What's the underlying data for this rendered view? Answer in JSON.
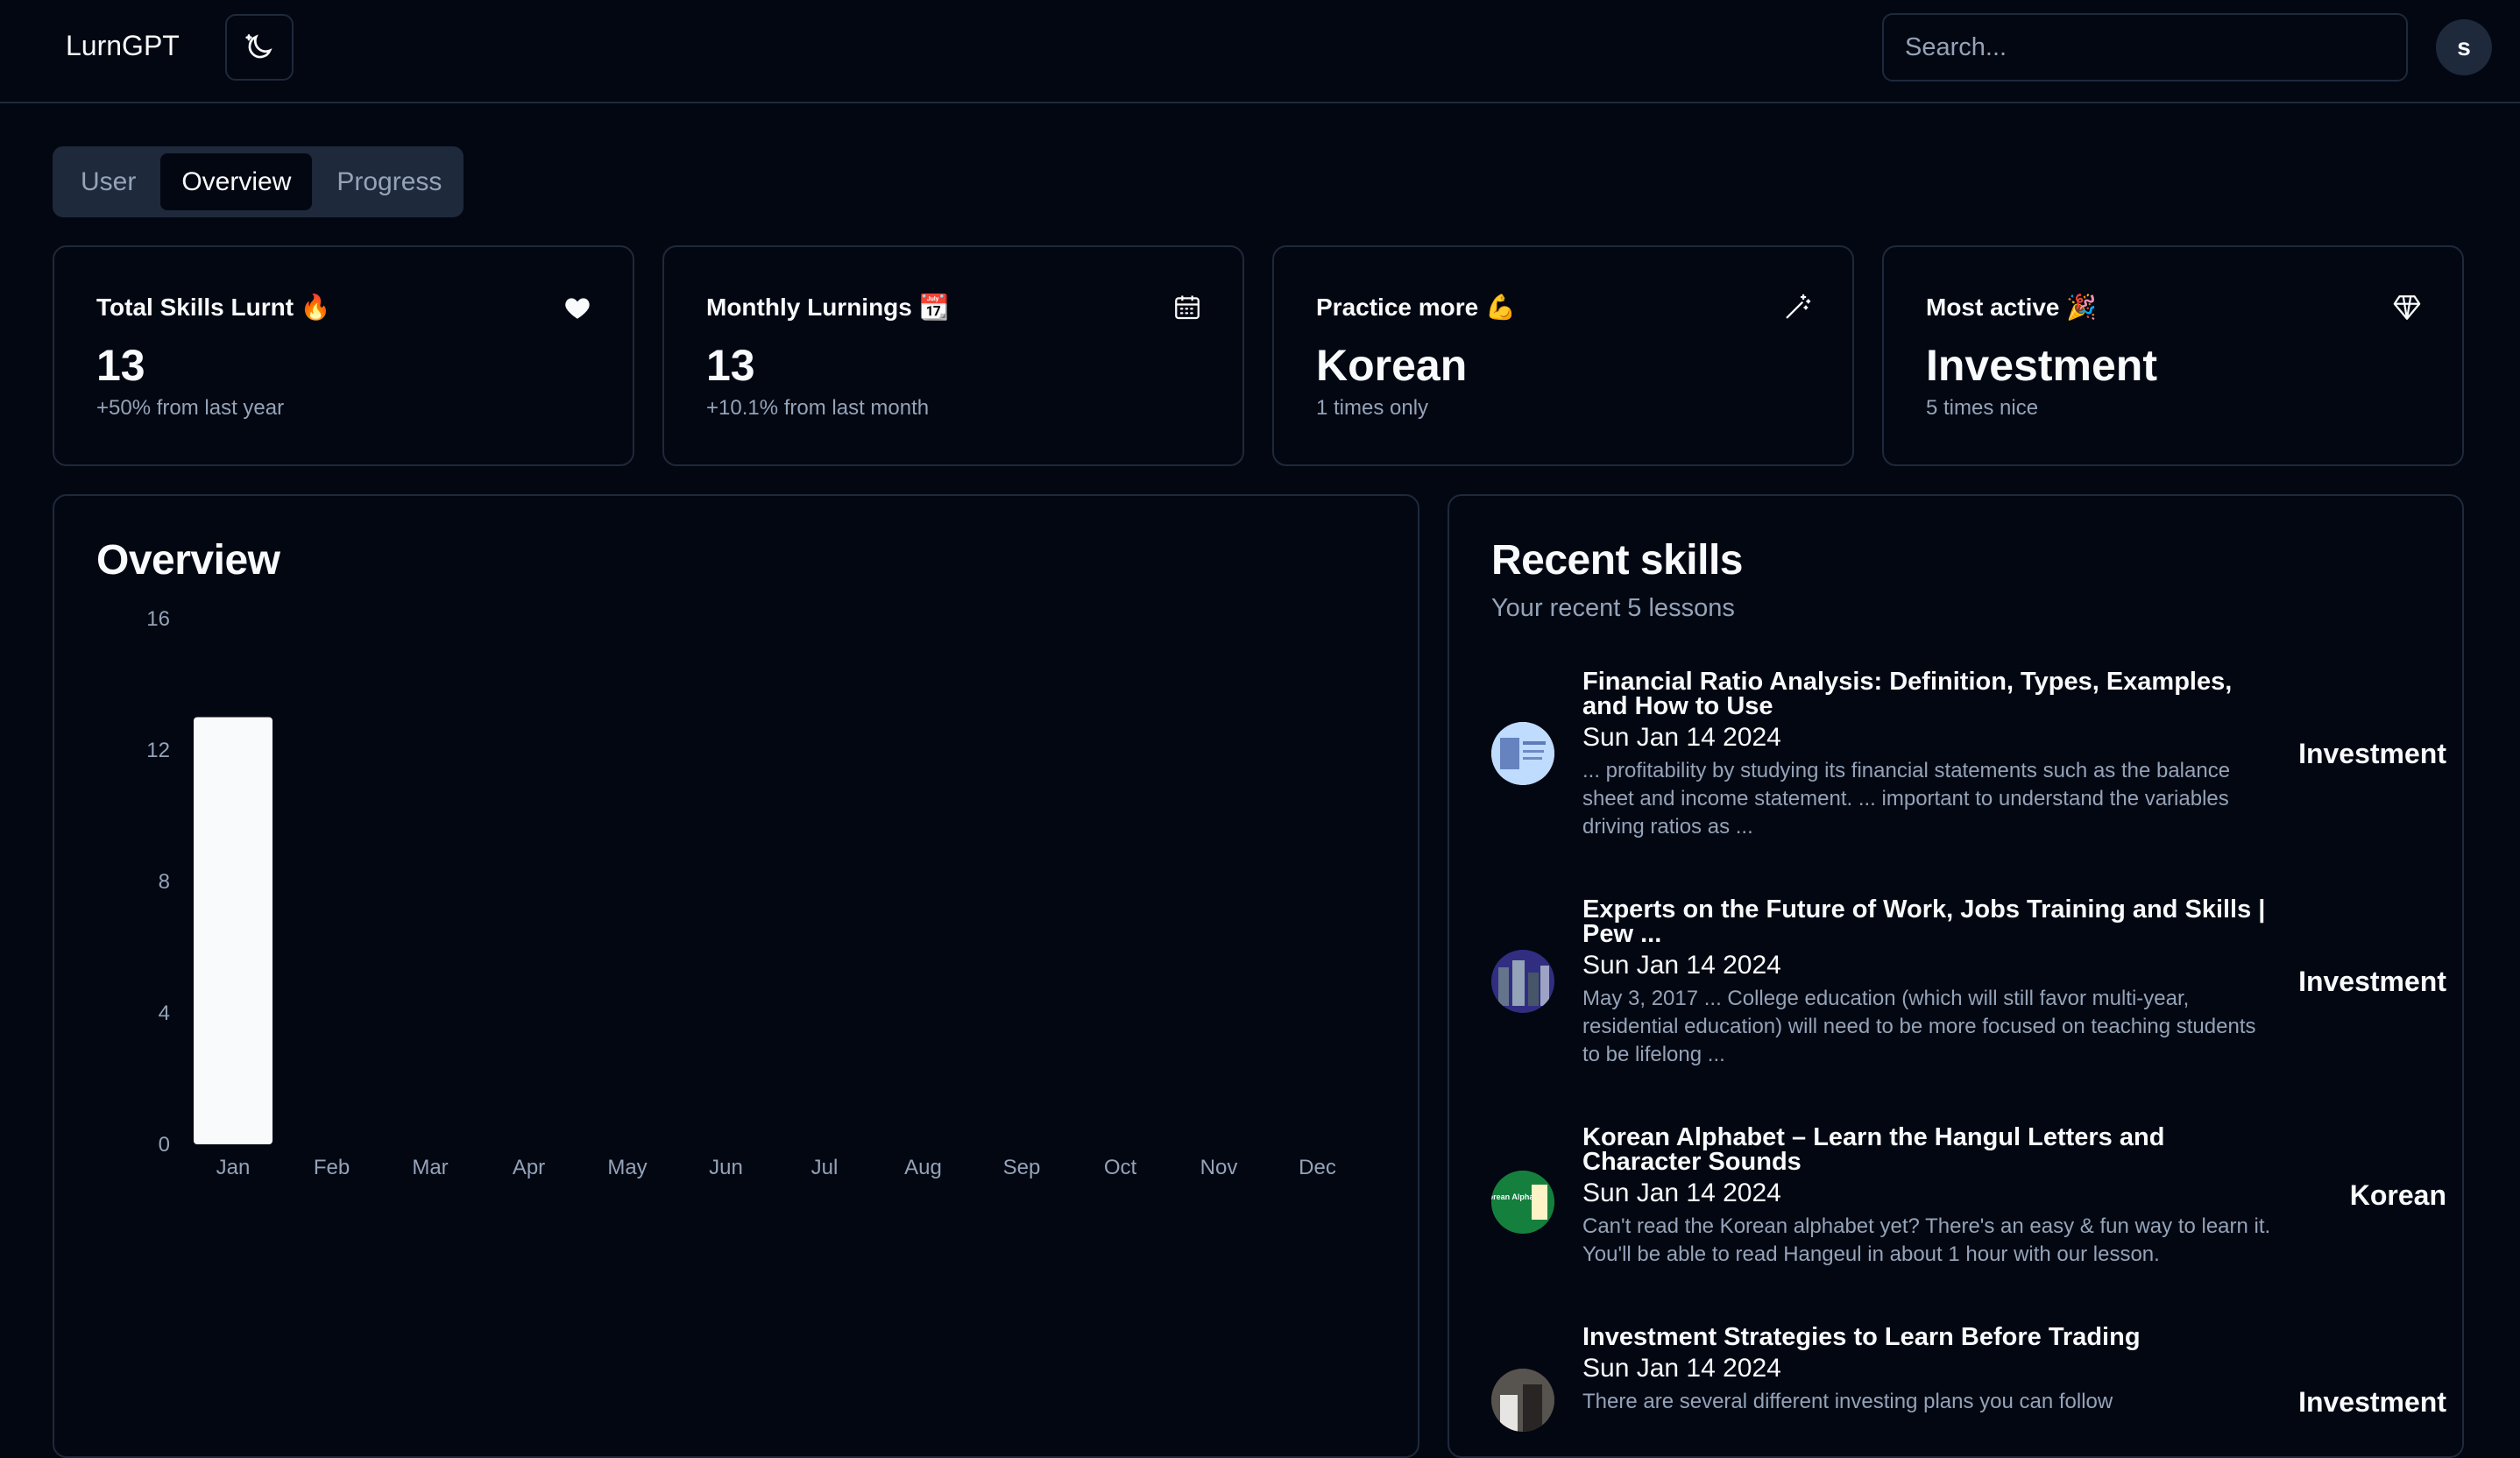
{
  "app": {
    "brand": "LurnGPT",
    "avatar_initial": "s"
  },
  "search": {
    "placeholder": "Search..."
  },
  "tabs": [
    {
      "label": "User",
      "active": false
    },
    {
      "label": "Overview",
      "active": true
    },
    {
      "label": "Progress",
      "active": false
    }
  ],
  "stats": [
    {
      "title": "Total Skills Lurnt 🔥",
      "value": "13",
      "sub": "+50% from last year",
      "icon": "heart-icon"
    },
    {
      "title": "Monthly Lurnings 📆",
      "value": "13",
      "sub": "+10.1% from last month",
      "icon": "calendar-icon"
    },
    {
      "title": "Practice more 💪",
      "value": "Korean",
      "sub": "1 times only",
      "icon": "wand-icon"
    },
    {
      "title": "Most active 🎉",
      "value": "Investment",
      "sub": "5 times nice",
      "icon": "gem-icon"
    }
  ],
  "overview": {
    "title": "Overview",
    "chart_data": {
      "type": "bar",
      "categories": [
        "Jan",
        "Feb",
        "Mar",
        "Apr",
        "May",
        "Jun",
        "Jul",
        "Aug",
        "Sep",
        "Oct",
        "Nov",
        "Dec"
      ],
      "values": [
        13,
        0,
        0,
        0,
        0,
        0,
        0,
        0,
        0,
        0,
        0,
        0
      ],
      "yticks": [
        0,
        4,
        8,
        12,
        16
      ],
      "ylim": [
        0,
        16
      ],
      "bar_color": "#f8fafc",
      "grid": false
    }
  },
  "recent": {
    "title": "Recent skills",
    "subtitle": "Your recent 5 lessons",
    "items": [
      {
        "title": "Financial Ratio Analysis: Definition, Types, Examples, and How to Use",
        "date": "Sun Jan 14 2024",
        "desc": "... profitability by studying its financial statements such as the balance sheet and income statement. ... important to understand the variables driving ratios as ...",
        "category": "Investment"
      },
      {
        "title": "Experts on the Future of Work, Jobs Training and Skills | Pew ...",
        "date": "Sun Jan 14 2024",
        "desc": "May 3, 2017 ... College education (which will still favor multi-year, residential education) will need to be more focused on teaching students to be lifelong ...",
        "category": "Investment"
      },
      {
        "title": "Korean Alphabet – Learn the Hangul Letters and Character Sounds",
        "date": "Sun Jan 14 2024",
        "desc": "Can't read the Korean alphabet yet? There's an easy & fun way to learn it. You'll be able to read Hangeul in about 1 hour with our lesson.",
        "category": "Korean",
        "thumb_text": "Korean Alphabet"
      },
      {
        "title": "Investment Strategies to Learn Before Trading",
        "date": "Sun Jan 14 2024",
        "desc": "There are several different investing plans you can follow",
        "category": "Investment"
      }
    ]
  }
}
